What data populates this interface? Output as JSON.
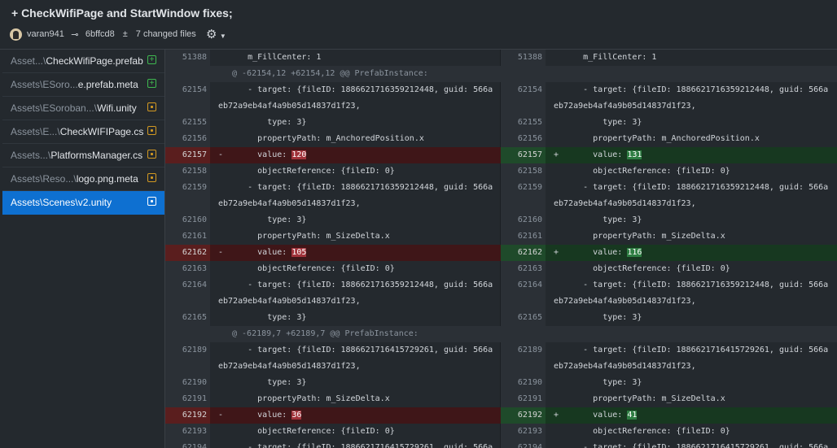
{
  "commit": {
    "title": "+ CheckWifiPage and StartWindow fixes;",
    "author": "varan941",
    "sha": "6bffcd8",
    "changed": "7 changed files"
  },
  "files": [
    {
      "dim": "Asset...\\",
      "name": "CheckWifiPage.prefab",
      "status": "added"
    },
    {
      "dim": "Assets\\ESoro...",
      "name": "e.prefab.meta",
      "status": "added"
    },
    {
      "dim": "Assets\\ESoroban...\\",
      "name": "Wifi.unity",
      "status": "modified"
    },
    {
      "dim": "Assets\\E...\\",
      "name": "CheckWIFIPage.cs",
      "status": "modified"
    },
    {
      "dim": "Assets...\\",
      "name": "PlatformsManager.cs",
      "status": "modified"
    },
    {
      "dim": "Assets\\Reso...\\",
      "name": "logo.png.meta",
      "status": "modified"
    },
    {
      "dim": "Assets\\Scenes\\",
      "name": "v2.unity",
      "status": "modified",
      "selected": true
    }
  ],
  "rows": [
    {
      "t": "ctx",
      "ln": "51388",
      "lt": "      m_FillCenter: 1",
      "rn": "51388",
      "rt": "      m_FillCenter: 1"
    },
    {
      "t": "hunk",
      "lt": "@ -62154,12 +62154,12 @@ PrefabInstance:"
    },
    {
      "t": "ctx",
      "ln": "62154",
      "lt": "      - target: {fileID: 1886621716359212448, guid: 566a",
      "rn": "62154",
      "rt": "      - target: {fileID: 1886621716359212448, guid: 566a"
    },
    {
      "t": "ctx",
      "ln": "",
      "lt": "eb72a9eb4af4a9b05d14837d1f23,",
      "rn": "",
      "rt": "eb72a9eb4af4a9b05d14837d1f23,"
    },
    {
      "t": "ctx",
      "ln": "62155",
      "lt": "          type: 3}",
      "rn": "62155",
      "rt": "          type: 3}"
    },
    {
      "t": "ctx",
      "ln": "62156",
      "lt": "        propertyPath: m_AnchoredPosition.x",
      "rn": "62156",
      "rt": "        propertyPath: m_AnchoredPosition.x"
    },
    {
      "t": "chg",
      "ln": "62157",
      "lpre": "        value: ",
      "lval": "120",
      "rn": "62157",
      "rpre": "        value: ",
      "rval": "131"
    },
    {
      "t": "ctx",
      "ln": "62158",
      "lt": "        objectReference: {fileID: 0}",
      "rn": "62158",
      "rt": "        objectReference: {fileID: 0}"
    },
    {
      "t": "ctx",
      "ln": "62159",
      "lt": "      - target: {fileID: 1886621716359212448, guid: 566a",
      "rn": "62159",
      "rt": "      - target: {fileID: 1886621716359212448, guid: 566a"
    },
    {
      "t": "ctx",
      "ln": "",
      "lt": "eb72a9eb4af4a9b05d14837d1f23,",
      "rn": "",
      "rt": "eb72a9eb4af4a9b05d14837d1f23,"
    },
    {
      "t": "ctx",
      "ln": "62160",
      "lt": "          type: 3}",
      "rn": "62160",
      "rt": "          type: 3}"
    },
    {
      "t": "ctx",
      "ln": "62161",
      "lt": "        propertyPath: m_SizeDelta.x",
      "rn": "62161",
      "rt": "        propertyPath: m_SizeDelta.x"
    },
    {
      "t": "chg",
      "ln": "62162",
      "lpre": "        value: ",
      "lval": "105",
      "rn": "62162",
      "rpre": "        value: ",
      "rval": "116"
    },
    {
      "t": "ctx",
      "ln": "62163",
      "lt": "        objectReference: {fileID: 0}",
      "rn": "62163",
      "rt": "        objectReference: {fileID: 0}"
    },
    {
      "t": "ctx",
      "ln": "62164",
      "lt": "      - target: {fileID: 1886621716359212448, guid: 566a",
      "rn": "62164",
      "rt": "      - target: {fileID: 1886621716359212448, guid: 566a"
    },
    {
      "t": "ctx",
      "ln": "",
      "lt": "eb72a9eb4af4a9b05d14837d1f23,",
      "rn": "",
      "rt": "eb72a9eb4af4a9b05d14837d1f23,"
    },
    {
      "t": "ctx",
      "ln": "62165",
      "lt": "          type: 3}",
      "rn": "62165",
      "rt": "          type: 3}"
    },
    {
      "t": "hunk",
      "lt": "@ -62189,7 +62189,7 @@ PrefabInstance:"
    },
    {
      "t": "ctx",
      "ln": "62189",
      "lt": "      - target: {fileID: 1886621716415729261, guid: 566a",
      "rn": "62189",
      "rt": "      - target: {fileID: 1886621716415729261, guid: 566a"
    },
    {
      "t": "ctx",
      "ln": "",
      "lt": "eb72a9eb4af4a9b05d14837d1f23,",
      "rn": "",
      "rt": "eb72a9eb4af4a9b05d14837d1f23,"
    },
    {
      "t": "ctx",
      "ln": "62190",
      "lt": "          type: 3}",
      "rn": "62190",
      "rt": "          type: 3}"
    },
    {
      "t": "ctx",
      "ln": "62191",
      "lt": "        propertyPath: m_SizeDelta.x",
      "rn": "62191",
      "rt": "        propertyPath: m_SizeDelta.x"
    },
    {
      "t": "chg",
      "ln": "62192",
      "lpre": "        value: ",
      "lval": "36",
      "rn": "62192",
      "rpre": "        value: ",
      "rval": "41"
    },
    {
      "t": "ctx",
      "ln": "62193",
      "lt": "        objectReference: {fileID: 0}",
      "rn": "62193",
      "rt": "        objectReference: {fileID: 0}"
    },
    {
      "t": "ctx",
      "ln": "62194",
      "lt": "      - target: {fileID: 1886621716415729261, guid: 566a",
      "rn": "62194",
      "rt": "      - target: {fileID: 1886621716415729261, guid: 566a"
    }
  ],
  "signs": {
    "del": "-",
    "add": "+"
  },
  "icons": {
    "commit": "commit-icon",
    "files": "diff-files-icon",
    "settings": "gear-icon"
  },
  "colors": {
    "selected": "#0e70d1",
    "added": "#3fb950",
    "modified": "#d29922",
    "deleted_bg": "#3f1618",
    "added_bg": "#173820"
  }
}
